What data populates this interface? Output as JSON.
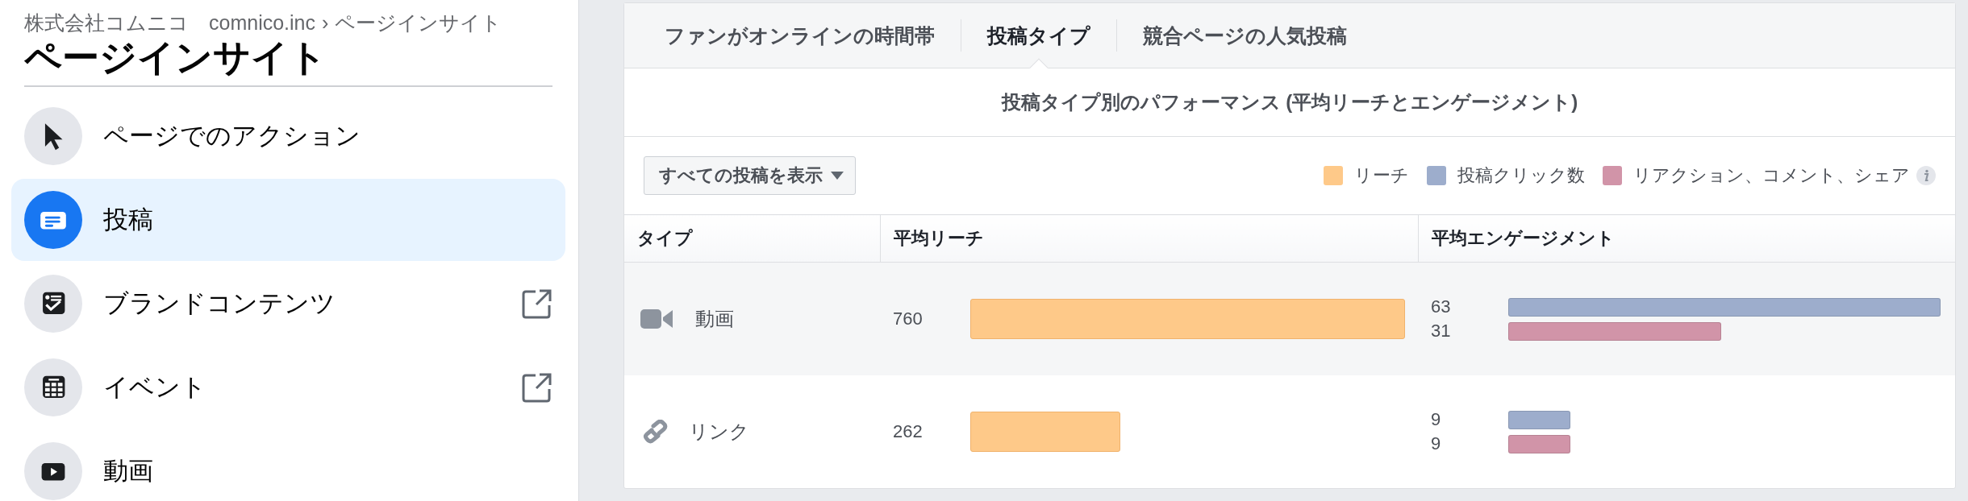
{
  "breadcrumb": {
    "page_name": "株式会社コムニコ　comnico.inc",
    "separator": "›",
    "current": "ページインサイト"
  },
  "title": "ページインサイト",
  "sidebar": {
    "items": [
      {
        "label": "ページでのアクション",
        "selected": false,
        "external": false
      },
      {
        "label": "投稿",
        "selected": true,
        "external": false
      },
      {
        "label": "ブランドコンテンツ",
        "selected": false,
        "external": true
      },
      {
        "label": "イベント",
        "selected": false,
        "external": true
      },
      {
        "label": "動画",
        "selected": false,
        "external": false
      }
    ]
  },
  "tabs": [
    {
      "label": "ファンがオンラインの時間帯",
      "selected": false
    },
    {
      "label": "投稿タイプ",
      "selected": true
    },
    {
      "label": "競合ページの人気投稿",
      "selected": false
    }
  ],
  "panel": {
    "title": "投稿タイプ別のパフォーマンス (平均リーチとエンゲージメント)",
    "filter": "すべての投稿を表示",
    "legend": [
      {
        "label": "リーチ",
        "color": "#fec989"
      },
      {
        "label": "投稿クリック数",
        "color": "#9dadcc"
      },
      {
        "label": "リアクション、コメント、シェア",
        "color": "#d194a8"
      }
    ],
    "table": {
      "columns": [
        "タイプ",
        "平均リーチ",
        "平均エンゲージメント"
      ],
      "rows": [
        {
          "type": "動画",
          "selected": true,
          "reach": "760",
          "engagement": [
            "63",
            "31"
          ]
        },
        {
          "type": "リンク",
          "selected": false,
          "reach": "262",
          "engagement": [
            "9",
            "9"
          ]
        }
      ]
    }
  }
}
